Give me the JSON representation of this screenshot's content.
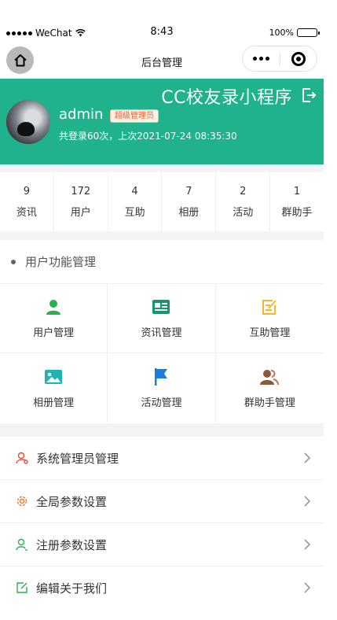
{
  "status_bar": {
    "carrier": "WeChat",
    "time": "8:43",
    "battery": "100%"
  },
  "nav": {
    "title": "后台管理"
  },
  "header": {
    "app_title": "CC校友录小程序",
    "admin_name": "admin",
    "role_badge": "超级管理员",
    "login_info": "共登录60次，上次2021-07-24 08:35:30",
    "bg_color": "#20b28c"
  },
  "stats": [
    {
      "value": "9",
      "label": "资讯"
    },
    {
      "value": "172",
      "label": "用户"
    },
    {
      "value": "4",
      "label": "互助"
    },
    {
      "value": "7",
      "label": "相册"
    },
    {
      "value": "2",
      "label": "活动"
    },
    {
      "value": "1",
      "label": "群助手"
    }
  ],
  "functions": {
    "title": "用户功能管理",
    "items": [
      {
        "label": "用户管理",
        "icon": "user-icon",
        "color": "#2bb04a"
      },
      {
        "label": "资讯管理",
        "icon": "news-card-icon",
        "color": "#17956e"
      },
      {
        "label": "互助管理",
        "icon": "edit-note-icon",
        "color": "#f5b62c"
      },
      {
        "label": "相册管理",
        "icon": "picture-icon",
        "color": "#20b3b0"
      },
      {
        "label": "活动管理",
        "icon": "flag-icon",
        "color": "#1a7de0"
      },
      {
        "label": "群助手管理",
        "icon": "group-icon",
        "color": "#8a5a3c"
      }
    ]
  },
  "settings": [
    {
      "label": "系统管理员管理",
      "icon": "admin-user-icon",
      "color": "#e14b3b"
    },
    {
      "label": "全局参数设置",
      "icon": "gear-icon",
      "color": "#ea7a36"
    },
    {
      "label": "注册参数设置",
      "icon": "register-user-icon",
      "color": "#2bb04a"
    },
    {
      "label": "编辑关于我们",
      "icon": "edit-icon",
      "color": "#2bb04a"
    }
  ]
}
